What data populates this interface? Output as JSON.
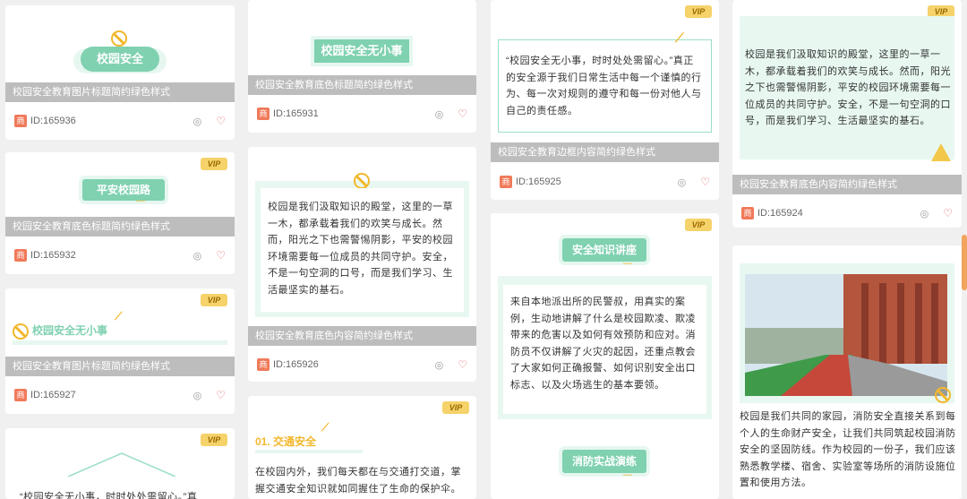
{
  "cards": {
    "c1": {
      "title_label": "校园安全",
      "caption": "校园安全教育图片标题简约绿色样式",
      "id": "ID:165936"
    },
    "c2": {
      "vip": "VIP",
      "title_label": "平安校园路",
      "caption": "校园安全教育底色标题简约绿色样式",
      "id": "ID:165932"
    },
    "c3": {
      "vip": "VIP",
      "title_label": "校园安全无小事",
      "caption": "校园安全教育图片标题简约绿色样式",
      "id": "ID:165927"
    },
    "c4": {
      "vip": "VIP",
      "text": "“校园安全无小事，时时处处需留心。”真"
    },
    "c5": {
      "title_label": "校园安全无小事",
      "caption": "校园安全教育底色标题简约绿色样式",
      "id": "ID:165931"
    },
    "c6": {
      "text": "校园是我们汲取知识的殿堂，这里的一草一木，都承载着我们的欢笑与成长。然而，阳光之下也需警惕阴影，平安的校园环境需要每一位成员的共同守护。安全，不是一句空洞的口号，而是我们学习、生活最坚实的基石。",
      "caption": "校园安全教育底色内容简约绿色样式",
      "id": "ID:165926"
    },
    "c7": {
      "vip": "VIP",
      "heading": "01. 交通安全",
      "text": "在校园内外，我们每天都在与交通打交道，掌握交通安全知识就如同握住了生命的保护伞。"
    },
    "c8": {
      "vip": "VIP",
      "text": "“校园安全无小事，时时处处需留心。”真正的安全源于我们日常生活中每一个谨慎的行为、每一次对规则的遵守和每一份对他人与自己的责任感。",
      "caption": "校园安全教育边框内容简约绿色样式",
      "id": "ID:165925"
    },
    "c9": {
      "vip": "VIP",
      "title_label": "安全知识讲座",
      "text": "来自本地派出所的民警叔，用真实的案例，生动地讲解了什么是校园欺凌、欺凌带来的危害以及如何有效预防和应对。消防员不仅讲解了火灾的起因，还重点教会了大家如何正确报警、如何识别安全出口标志、以及火场逃生的基本要领。",
      "title2": "消防实战演练"
    },
    "c10": {
      "vip": "VIP",
      "text": "校园是我们汲取知识的殿堂，这里的一草一木，都承载着我们的欢笑与成长。然而，阳光之下也需警惕阴影，平安的校园环境需要每一位成员的共同守护。安全，不是一句空洞的口号，而是我们学习、生活最坚实的基石。",
      "caption": "校园安全教育底色内容简约绿色样式",
      "id": "ID:165924"
    },
    "c11": {
      "text": "校园是我们共同的家园，消防安全直接关系到每个人的生命财产安全，让我们共同筑起校园消防安全的坚固防线。作为校园的一份子，我们应该熟悉教学楼、宿舍、实验室等场所的消防设施位置和使用方法。"
    }
  },
  "shang_label": "商",
  "icons": {
    "eye": "eye-slash-icon",
    "heart": "heart-icon"
  }
}
